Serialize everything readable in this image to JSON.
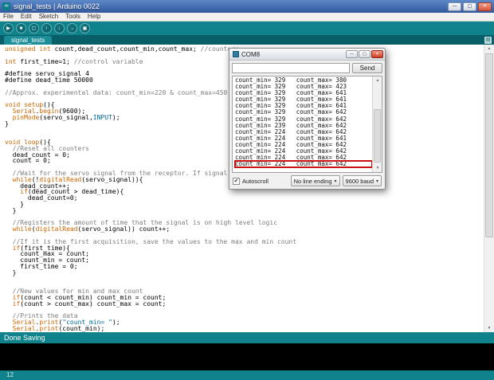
{
  "window": {
    "title": "signal_tests | Arduino 0022",
    "app_icon_glyph": "∞",
    "minimize_glyph": "—",
    "maximize_glyph": "▢",
    "close_glyph": "✕"
  },
  "menu": {
    "items": [
      "File",
      "Edit",
      "Sketch",
      "Tools",
      "Help"
    ]
  },
  "toolbar": {
    "buttons": [
      {
        "name": "verify-button",
        "glyph": "▶"
      },
      {
        "name": "stop-button",
        "glyph": "■"
      },
      {
        "name": "new-sketch-button",
        "glyph": "▢"
      },
      {
        "name": "open-button",
        "glyph": "↑"
      },
      {
        "name": "save-button",
        "glyph": "↓"
      },
      {
        "name": "upload-button",
        "glyph": "→"
      },
      {
        "name": "serial-monitor-button",
        "glyph": "▣"
      }
    ]
  },
  "tabbar": {
    "active_tab": "signal_tests",
    "tab_menu_glyph": "▤"
  },
  "editor": {
    "lines": [
      [
        [
          "unsigned int",
          "k"
        ],
        [
          " count,dead_count,count_min,count_max; ",
          "p"
        ],
        [
          "//counters",
          "c"
        ]
      ],
      [],
      [
        [
          "int",
          "k"
        ],
        [
          " first_time=1; ",
          "p"
        ],
        [
          "//control variable",
          "c"
        ]
      ],
      [],
      [
        [
          "#define servo_signal 4",
          "p"
        ]
      ],
      [
        [
          "#define dead_time 50000",
          "p"
        ]
      ],
      [],
      [
        [
          "//Approx. experimental data: count_min=220 & count_max=450",
          "c"
        ]
      ],
      [],
      [
        [
          "void setup",
          "k"
        ],
        [
          "(){",
          "p"
        ]
      ],
      [
        [
          "  ",
          "p"
        ],
        [
          "Serial",
          "k"
        ],
        [
          ".",
          "p"
        ],
        [
          "begin",
          "k"
        ],
        [
          "(9600);",
          "p"
        ]
      ],
      [
        [
          "  ",
          "p"
        ],
        [
          "pinMode",
          "k"
        ],
        [
          "(servo_signal,",
          "p"
        ],
        [
          "INPUT",
          "s"
        ],
        [
          ");",
          "p"
        ]
      ],
      [
        [
          "}",
          "p"
        ]
      ],
      [],
      [],
      [
        [
          "void loop",
          "k"
        ],
        [
          "(){",
          "p"
        ]
      ],
      [
        [
          "  ",
          "p"
        ],
        [
          "//Reset all counters",
          "c"
        ]
      ],
      [
        [
          "  dead_count = 0;",
          "p"
        ]
      ],
      [
        [
          "  count = 0;",
          "p"
        ]
      ],
      [],
      [
        [
          "  ",
          "p"
        ],
        [
          "//Wait for the servo signal from the receptor. If signal no longer exists (LOST SIGNAL)",
          "c"
        ]
      ],
      [
        [
          "  ",
          "p"
        ],
        [
          "while",
          "k"
        ],
        [
          "(!",
          "p"
        ],
        [
          "digitalRead",
          "k"
        ],
        [
          "(servo_signal)){",
          "p"
        ]
      ],
      [
        [
          "    dead_count++;",
          "p"
        ]
      ],
      [
        [
          "    ",
          "p"
        ],
        [
          "if",
          "k"
        ],
        [
          "(dead_count > dead_time){",
          "p"
        ]
      ],
      [
        [
          "      dead_count=0;",
          "p"
        ]
      ],
      [
        [
          "    }",
          "p"
        ]
      ],
      [
        [
          "  }",
          "p"
        ]
      ],
      [],
      [
        [
          "  ",
          "p"
        ],
        [
          "//Registers the amount of time that the signal is on high level logic",
          "c"
        ]
      ],
      [
        [
          "  ",
          "p"
        ],
        [
          "while",
          "k"
        ],
        [
          "(",
          "p"
        ],
        [
          "digitalRead",
          "k"
        ],
        [
          "(servo_signal)) count++;",
          "p"
        ]
      ],
      [],
      [
        [
          "  ",
          "p"
        ],
        [
          "//If it is the first acquisition, save the values to the max and min count",
          "c"
        ]
      ],
      [
        [
          "  ",
          "p"
        ],
        [
          "if",
          "k"
        ],
        [
          "(first_time){",
          "p"
        ]
      ],
      [
        [
          "    count_max = count;",
          "p"
        ]
      ],
      [
        [
          "    count_min = count;",
          "p"
        ]
      ],
      [
        [
          "    first_time = 0;",
          "p"
        ]
      ],
      [
        [
          "  }",
          "p"
        ]
      ],
      [],
      [],
      [
        [
          "  ",
          "p"
        ],
        [
          "//New values for min and max count",
          "c"
        ]
      ],
      [
        [
          "  ",
          "p"
        ],
        [
          "if",
          "k"
        ],
        [
          "(count < count_min) count_min = count;",
          "p"
        ]
      ],
      [
        [
          "  ",
          "p"
        ],
        [
          "if",
          "k"
        ],
        [
          "(count > count_max) count_max = count;",
          "p"
        ]
      ],
      [],
      [
        [
          "  ",
          "p"
        ],
        [
          "//Prints the data",
          "c"
        ]
      ],
      [
        [
          "  ",
          "p"
        ],
        [
          "Serial",
          "k"
        ],
        [
          ".",
          "p"
        ],
        [
          "print",
          "k"
        ],
        [
          "(",
          "p"
        ],
        [
          "\"count_min= \"",
          "s"
        ],
        [
          ");",
          "p"
        ]
      ],
      [
        [
          "  ",
          "p"
        ],
        [
          "Serial",
          "k"
        ],
        [
          ".",
          "p"
        ],
        [
          "print",
          "k"
        ],
        [
          "(count_min);",
          "p"
        ]
      ]
    ]
  },
  "status": {
    "message": "Done Saving"
  },
  "footer": {
    "line_indicator": "12"
  },
  "serial_monitor": {
    "title": "COM8",
    "input_value": "",
    "send_label": "Send",
    "autoscroll_label": "Autoscroll",
    "autoscroll_checked": true,
    "check_glyph": "✔",
    "line_ending_value": "No line ending",
    "baud_value": "9600 baud",
    "dropdown_arrow": "▾",
    "rows": [
      "count_min= 329   count_max= 380",
      "count_min= 329   count_max= 423",
      "count_min= 329   count_max= 641",
      "count_min= 329   count_max= 641",
      "count_min= 329   count_max= 641",
      "count_min= 329   count_max= 642",
      "count_min= 329   count_max= 642",
      "count_min= 239   count_max= 642",
      "count_min= 224   count_max= 642",
      "count_min= 224   count_max= 641",
      "count_min= 224   count_max= 642",
      "count_min= 224   count_max= 642",
      "count_min= 224   count_max= 642",
      "count_min= 224   count_max= 642"
    ],
    "highlight_row_index": 13
  },
  "colors": {
    "teal_main": "#0f828c",
    "teal_dark": "#085f68",
    "titlebar_blue": "#31589b",
    "keyword_orange": "#cc6600",
    "comment_gray": "#7e7e7e",
    "literal_blue": "#006699",
    "highlight_red": "#cc1111",
    "console_black": "#000000"
  }
}
